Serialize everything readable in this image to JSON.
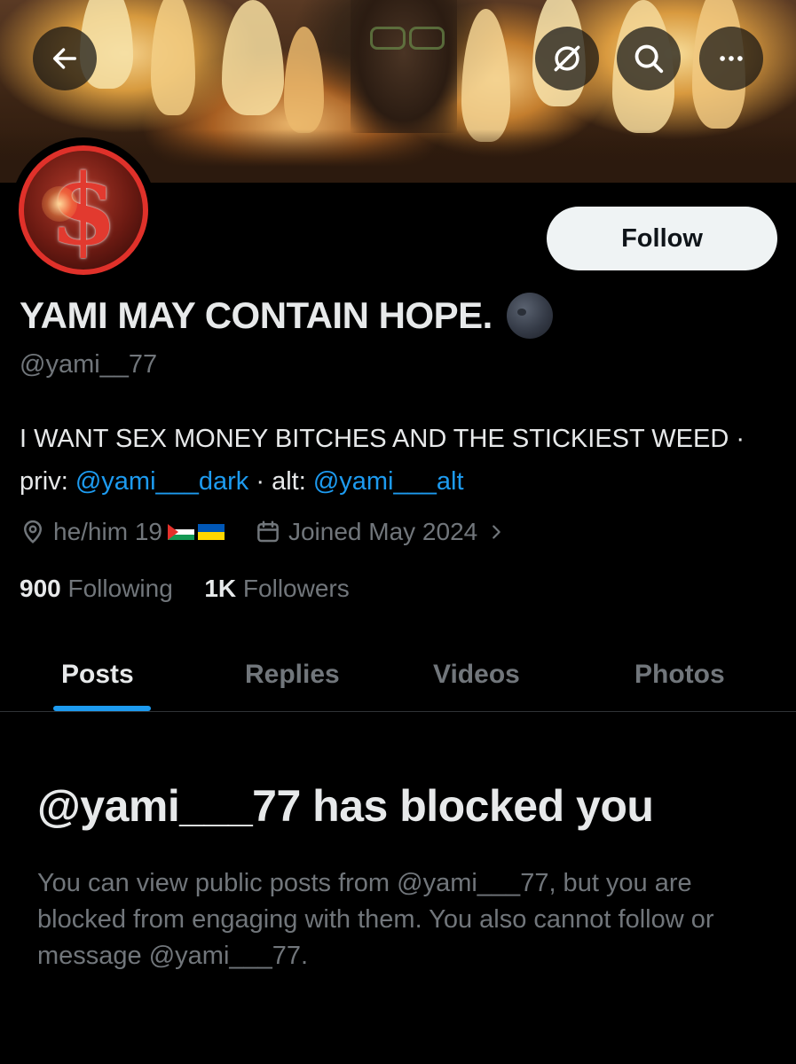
{
  "header": {
    "back_icon": "arrow-left-icon",
    "grok_icon": "grok-icon",
    "search_icon": "search-icon",
    "more_icon": "more-icon"
  },
  "profile": {
    "display_name": "YAMI MAY CONTAIN HOPE.",
    "display_name_emoji": "new-moon-emoji",
    "handle": "@yami__77",
    "follow_label": "Follow",
    "bio_text_1": "I WANT SEX MONEY BITCHES AND THE STICKIEST WEED · priv: ",
    "bio_link_1": "@yami___dark",
    "bio_text_2": " · alt: ",
    "bio_link_2": "@yami___alt",
    "pronouns_location": "he/him 19",
    "flags": [
      "palestine-flag",
      "ukraine-flag"
    ],
    "joined": "Joined May 2024",
    "following_count": "900",
    "following_label": "Following",
    "followers_count": "1K",
    "followers_label": "Followers"
  },
  "tabs": [
    {
      "label": "Posts",
      "active": true
    },
    {
      "label": "Replies",
      "active": false
    },
    {
      "label": "Videos",
      "active": false
    },
    {
      "label": "Photos",
      "active": false
    }
  ],
  "blocked": {
    "title": "@yami___77 has blocked you",
    "message": "You can view public posts from @yami___77, but you are blocked from engaging with them. You also cannot follow or message @yami___77."
  },
  "colors": {
    "background": "#000000",
    "accent": "#1d9bf0",
    "secondary_text": "#71767b",
    "primary_text": "#e7e9ea"
  }
}
